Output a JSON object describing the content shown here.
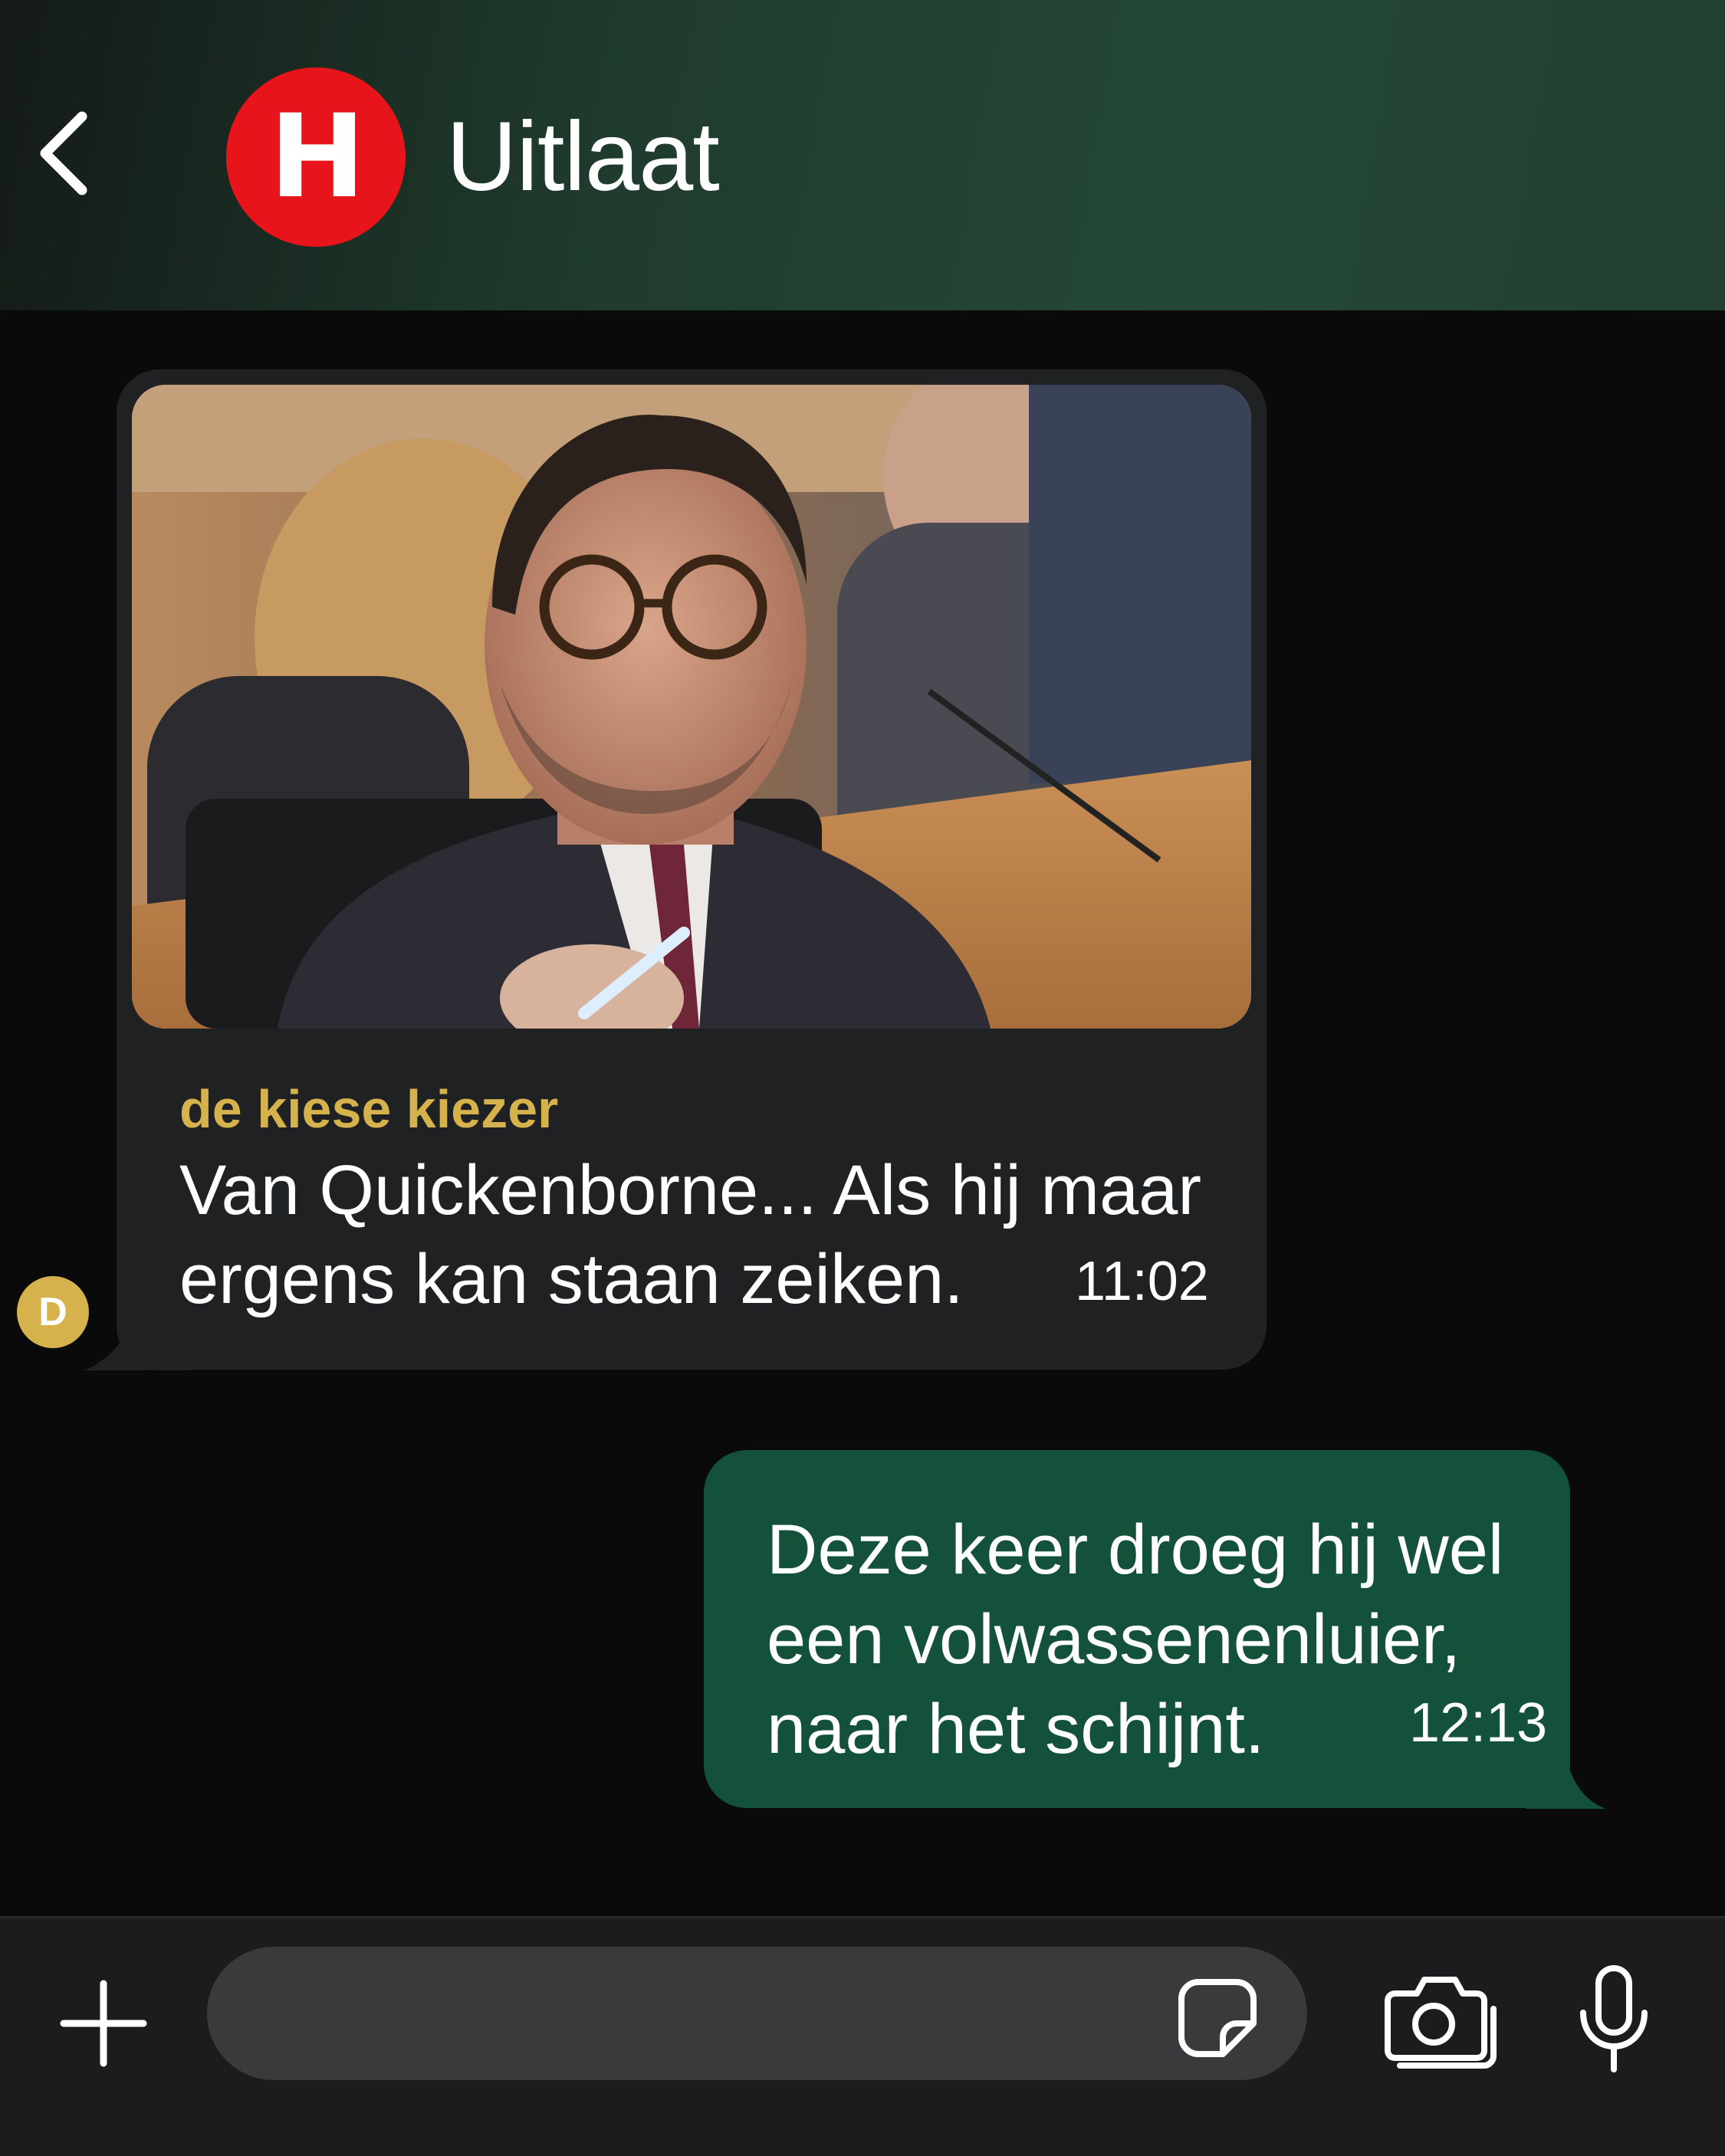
{
  "header": {
    "back_icon": "chevron-left-icon",
    "logo_letter": "H",
    "title": "Uitlaat"
  },
  "messages": [
    {
      "direction": "incoming",
      "sender": "de kiese kiezer",
      "avatar_initial": "D",
      "text": "Van Quickenborne... Als hij maar ergens kan staan zeiken.",
      "time": "11:02"
    },
    {
      "direction": "outgoing",
      "text": "Deze keer droeg hij wel een volwassenenluier, naar het schijnt.",
      "time": "12:13"
    }
  ],
  "composer": {
    "placeholder": "",
    "icons": [
      "plus-icon",
      "sticker-icon",
      "camera-icon",
      "microphone-icon"
    ]
  },
  "colors": {
    "logo_red": "#e8141b",
    "sender_gold": "#d6b24d",
    "incoming_bubble": "#1f2123",
    "outgoing_bubble": "#14513a",
    "header_green": "#254836"
  }
}
